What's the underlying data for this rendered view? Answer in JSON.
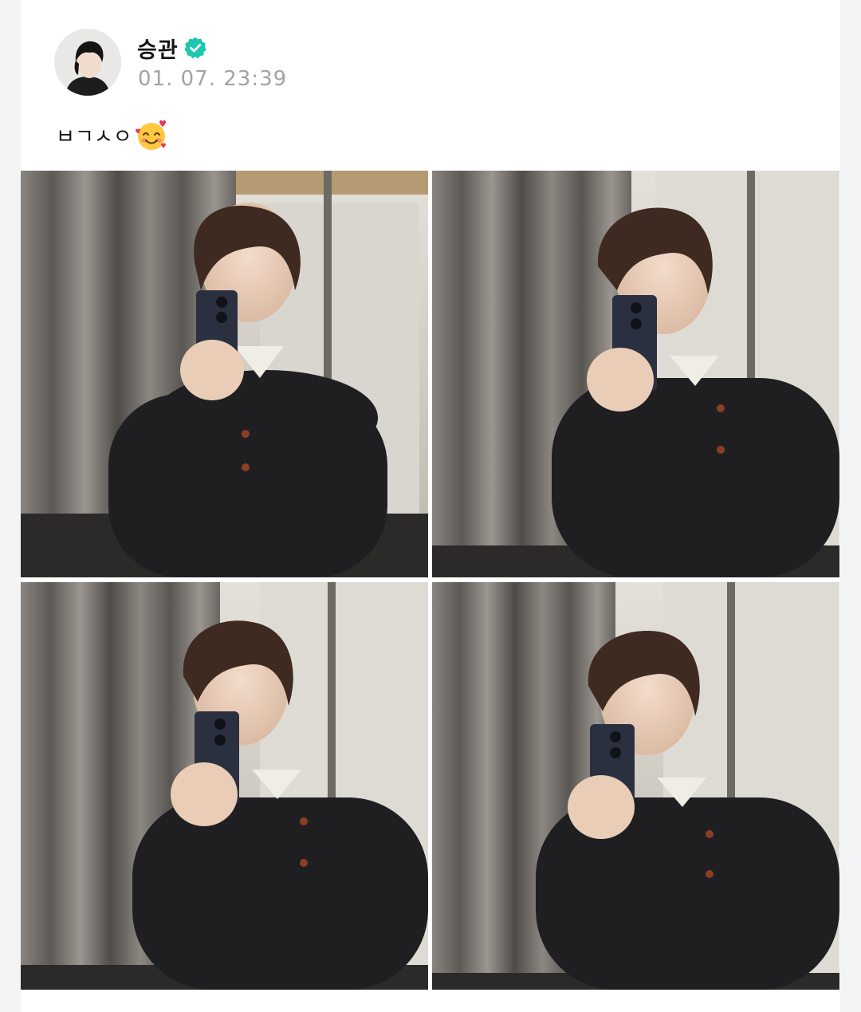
{
  "post": {
    "author": {
      "name": "승관",
      "verified_icon": "verified-badge-icon",
      "verified_color": "#1ec7b0"
    },
    "timestamp": "01. 07. 23:39",
    "text": "ㅂㄱㅅㅇ",
    "emoji": "smiling-face-with-hearts-emoji",
    "photos": [
      {
        "name": "mirror selfie 1"
      },
      {
        "name": "mirror selfie 2"
      },
      {
        "name": "mirror selfie 3"
      },
      {
        "name": "mirror selfie 4"
      }
    ]
  }
}
